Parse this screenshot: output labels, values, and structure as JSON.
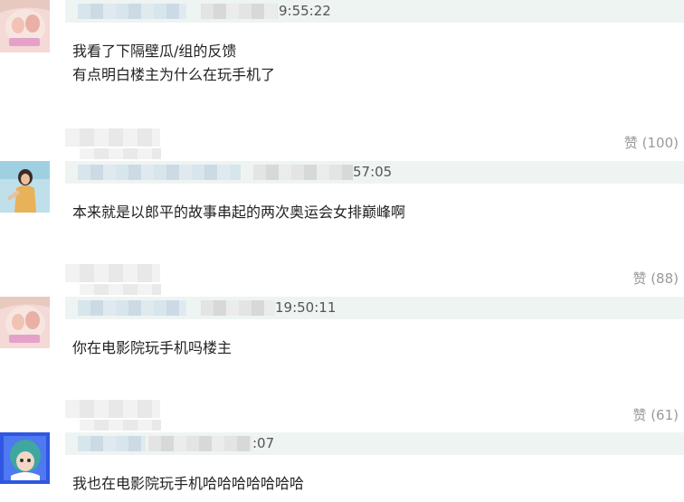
{
  "comments": [
    {
      "time_suffix": "9:55:22",
      "lines": [
        "我看了下隔壁瓜/组的反馈",
        "有点明白楼主为什么在玩手机了"
      ]
    },
    {
      "likes": "赞 (100)",
      "time_suffix": "57:05",
      "lines": [
        "本来就是以郎平的故事串起的两次奥运会女排巅峰啊"
      ]
    },
    {
      "likes": "赞 (88)",
      "time_suffix": "19:50:11",
      "lines": [
        "你在电影院玩手机吗楼主"
      ]
    },
    {
      "likes": "赞 (61)",
      "time_suffix": ":07",
      "lines": [
        "我也在电影院玩手机哈哈哈哈哈哈哈"
      ]
    }
  ]
}
